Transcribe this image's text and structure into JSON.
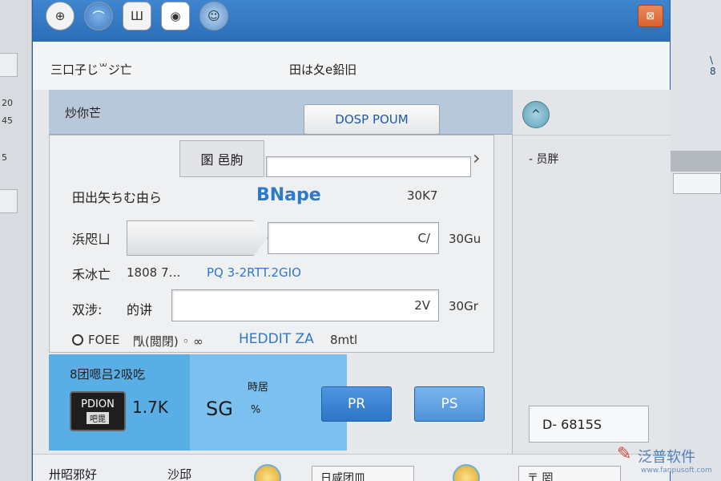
{
  "background_left": {
    "texts": [
      "20",
      "45",
      "5"
    ]
  },
  "background_right": {
    "text": "\\ 8"
  },
  "titlebar": {
    "buttons": [
      {
        "label": "⊕",
        "icon": "globe-icon"
      },
      {
        "label": "⌒",
        "icon": "cloud-icon"
      },
      {
        "label": "Ш",
        "icon": "grid-icon"
      },
      {
        "label": "◉",
        "icon": "record-icon"
      },
      {
        "label": "☺",
        "icon": "user-icon"
      }
    ],
    "close_label": "⊠"
  },
  "menubar": {
    "left": "三口子じ꒳ジ亡",
    "center": "田は夂е鉛旧"
  },
  "group_header": {
    "label": "炒你芒",
    "button": "DOSP POUM"
  },
  "form": {
    "tag": "圂 邑朐",
    "row1_label": "田出矢ちむ由ら",
    "row1_value": "BNape",
    "row1_unit": "30K7",
    "row2_label": "浜咫ㄩ",
    "row2_input": "C/",
    "row2_unit": "30Gu",
    "row3_label": "禾冰亡",
    "row3_text_plain": "1808 7…",
    "row3_text_accent": "PQ 3-2RTT.2GIO",
    "row4_label": "双涉:",
    "row4_label2": "的讲",
    "row4_input": "2V",
    "row4_unit": "30Gr",
    "radio_label": "FOEE",
    "radio_text": "閄(閲閉) ◦ ∞",
    "radio_accent": "HEDDIT ZA",
    "radio_tail": "8mtl"
  },
  "blue_panel": {
    "title": "8团嗯吕2吸吃",
    "badge_main": "PDION",
    "badge_sub": "吧毘",
    "value1": "1.7K",
    "label2": "時居",
    "value2": "SG",
    "value2_unit": "%"
  },
  "actions": {
    "primary": "PR",
    "secondary": "PS"
  },
  "right_panel": {
    "scroll_label": "^",
    "hint": "- 员胖",
    "field": "D- 6815S"
  },
  "bottom": {
    "left": "卅昭邪好",
    "mid": "沙邱",
    "box1": "日咸团皿",
    "box2": "〒 罔"
  },
  "watermark": {
    "name": "泛普软件",
    "url": "www.fanpusoft.com"
  }
}
